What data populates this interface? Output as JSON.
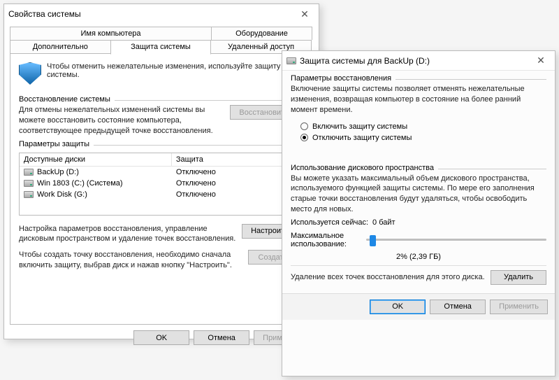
{
  "win1": {
    "title": "Свойства системы",
    "tabs": {
      "row1": [
        "Имя компьютера",
        "Оборудование"
      ],
      "row2": [
        "Дополнительно",
        "Защита системы",
        "Удаленный доступ"
      ],
      "active": "Защита системы"
    },
    "info_text": "Чтобы отменить нежелательные изменения, используйте защиту системы.",
    "section_restore": {
      "legend": "Восстановление системы",
      "text": "Для отмены нежелательных изменений системы вы можете восстановить состояние компьютера, соответствующее предыдущей точке восстановления.",
      "button": "Восстановить..."
    },
    "section_params": {
      "legend": "Параметры защиты",
      "headers": [
        "Доступные диски",
        "Защита"
      ],
      "rows": [
        {
          "name": "BackUp (D:)",
          "status": "Отключено"
        },
        {
          "name": "Win 1803 (C:) (Система)",
          "status": "Отключено"
        },
        {
          "name": "Work Disk (G:)",
          "status": "Отключено"
        }
      ],
      "configure_text": "Настройка параметров восстановления, управление дисковым пространством и удаление точек восстановления.",
      "configure_btn": "Настроить...",
      "create_text": "Чтобы создать точку восстановления, необходимо сначала включить защиту, выбрав диск и нажав кнопку \"Настроить\".",
      "create_btn": "Создать..."
    },
    "buttons": {
      "ok": "OK",
      "cancel": "Отмена",
      "apply": "Применить"
    }
  },
  "win2": {
    "title": "Защита системы для BackUp (D:)",
    "section_restore": {
      "legend": "Параметры восстановления",
      "text": "Включение защиты системы позволяет отменять нежелательные изменения, возвращая компьютер в состояние на более ранний момент времени.",
      "radio_enable": "Включить защиту системы",
      "radio_disable": "Отключить защиту системы",
      "selected": "disable"
    },
    "section_disk": {
      "legend": "Использование дискового пространства",
      "text": "Вы можете указать максимальный объем дискового пространства, используемого функцией защиты системы. По мере его заполнения старые точки восстановления будут удаляться, чтобы освободить место для новых.",
      "used_label": "Используется сейчас:",
      "used_value": "0 байт",
      "max_label": "Максимальное использование:",
      "slider_percent": 2,
      "slider_text": "2% (2,39 ГБ)",
      "delete_text": "Удаление всех точек восстановления для этого диска.",
      "delete_btn": "Удалить"
    },
    "buttons": {
      "ok": "OK",
      "cancel": "Отмена",
      "apply": "Применить"
    }
  }
}
